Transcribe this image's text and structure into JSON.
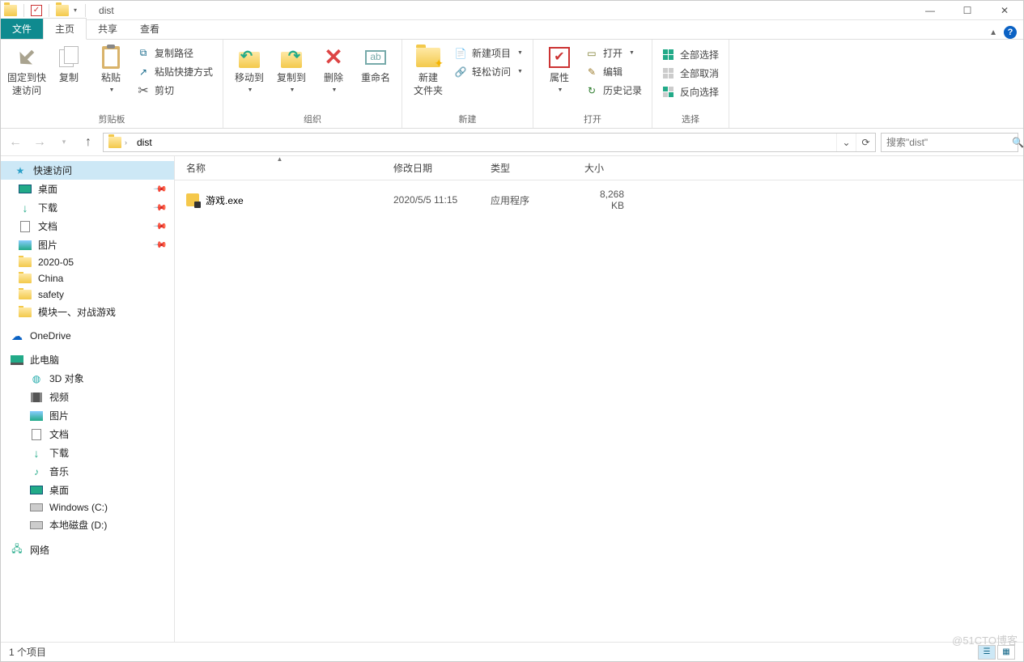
{
  "window": {
    "title": "dist"
  },
  "tabs": {
    "file": "文件",
    "home": "主页",
    "share": "共享",
    "view": "查看"
  },
  "ribbon": {
    "clipboard": {
      "label": "剪贴板",
      "pin": "固定到快\n速访问",
      "copy": "复制",
      "paste": "粘贴",
      "copy_path": "复制路径",
      "paste_shortcut": "粘贴快捷方式",
      "cut": "剪切"
    },
    "organize": {
      "label": "组织",
      "move_to": "移动到",
      "copy_to": "复制到",
      "delete": "删除",
      "rename": "重命名"
    },
    "new": {
      "label": "新建",
      "new_folder": "新建\n文件夹",
      "new_item": "新建项目",
      "easy_access": "轻松访问"
    },
    "open": {
      "label": "打开",
      "properties": "属性",
      "open": "打开",
      "edit": "编辑",
      "history": "历史记录"
    },
    "select": {
      "label": "选择",
      "select_all": "全部选择",
      "select_none": "全部取消",
      "invert": "反向选择"
    }
  },
  "address": {
    "crumb": "dist"
  },
  "search": {
    "placeholder": "搜索\"dist\""
  },
  "sidebar": {
    "quick_access": "快速访问",
    "desktop": "桌面",
    "downloads": "下载",
    "documents": "文档",
    "pictures": "图片",
    "f_2020_05": "2020-05",
    "f_china": "China",
    "f_safety": "safety",
    "f_module1": "模块一、对战游戏",
    "onedrive": "OneDrive",
    "this_pc": "此电脑",
    "objects_3d": "3D 对象",
    "videos": "视频",
    "pictures2": "图片",
    "documents2": "文档",
    "downloads2": "下载",
    "music": "音乐",
    "desktop2": "桌面",
    "drive_c": "Windows (C:)",
    "drive_d": "本地磁盘 (D:)",
    "network": "网络"
  },
  "columns": {
    "name": "名称",
    "date": "修改日期",
    "type": "类型",
    "size": "大小"
  },
  "files": [
    {
      "name": "游戏.exe",
      "date": "2020/5/5 11:15",
      "type": "应用程序",
      "size": "8,268 KB"
    }
  ],
  "status": {
    "text": "1 个项目"
  },
  "watermark": "@51CTO博客"
}
